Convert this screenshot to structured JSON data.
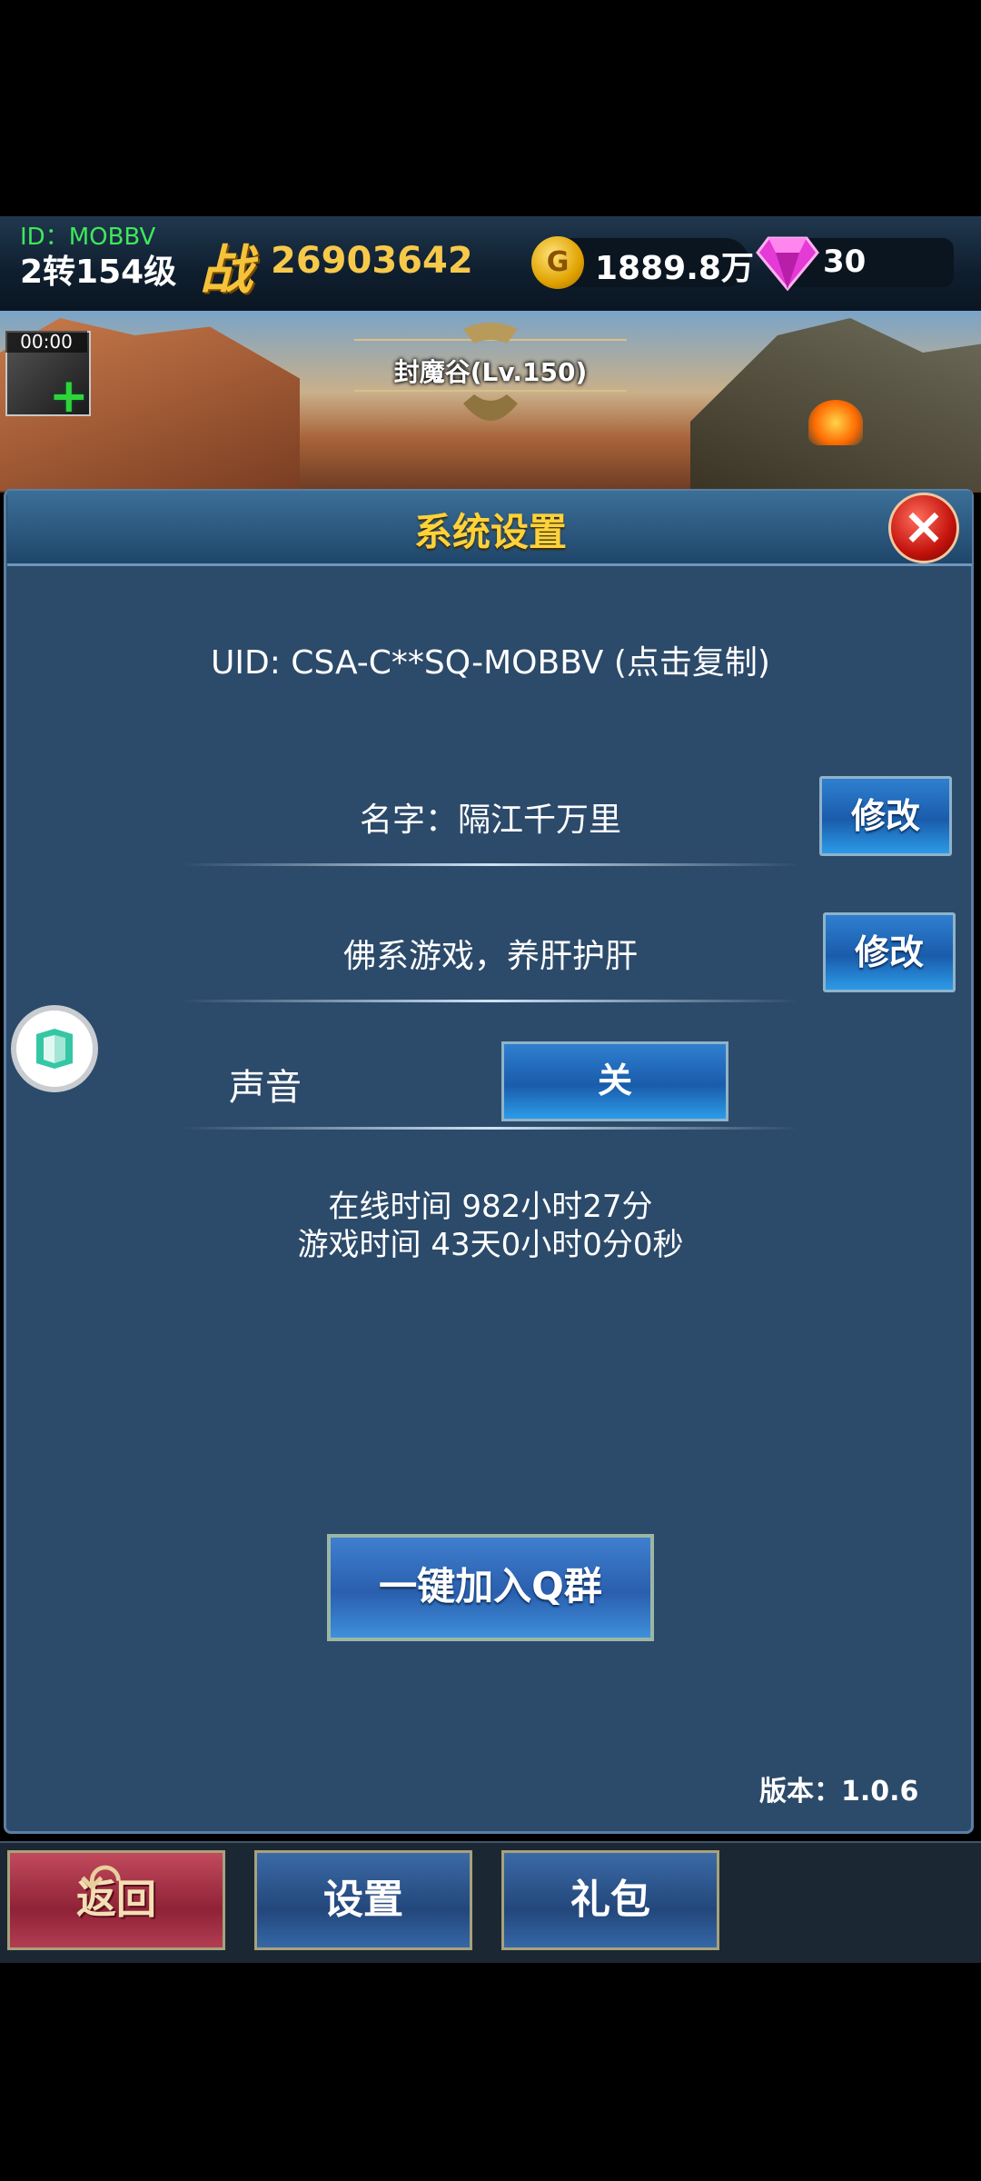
{
  "player": {
    "id": "ID：MOBBV",
    "level": "2转154级",
    "battle_icon": "战",
    "battle_power": "26903642"
  },
  "currency": {
    "gold_icon": "G",
    "gold": "1889.8万",
    "gems": "30"
  },
  "scene": {
    "map_name": "封魔谷(Lv.150)",
    "skill_timer": "00:00",
    "skill_plus": "+"
  },
  "settings": {
    "title": "系统设置",
    "close": "×",
    "uid": "UID: CSA-C**SQ-MOBBV (点击复制)",
    "name_label": "名字：隔江千万里",
    "name_edit": "修改",
    "signature": "佛系游戏，养肝护肝",
    "signature_edit": "修改",
    "sound_label": "声音",
    "sound_value": "关",
    "online_time": "在线时间 982小时27分",
    "play_time": "游戏时间 43天0小时0分0秒",
    "qq_group": "一键加入Q群",
    "version": "版本：1.0.6"
  },
  "nav": {
    "back": "返回",
    "back_arrow": "↶",
    "settings": "设置",
    "gift": "礼包"
  },
  "colors": {
    "panel_bg": "#2c4a6a",
    "title_gold": "#ffd23a",
    "button_blue": "#1a5cab",
    "level_green": "#3ee85a"
  }
}
